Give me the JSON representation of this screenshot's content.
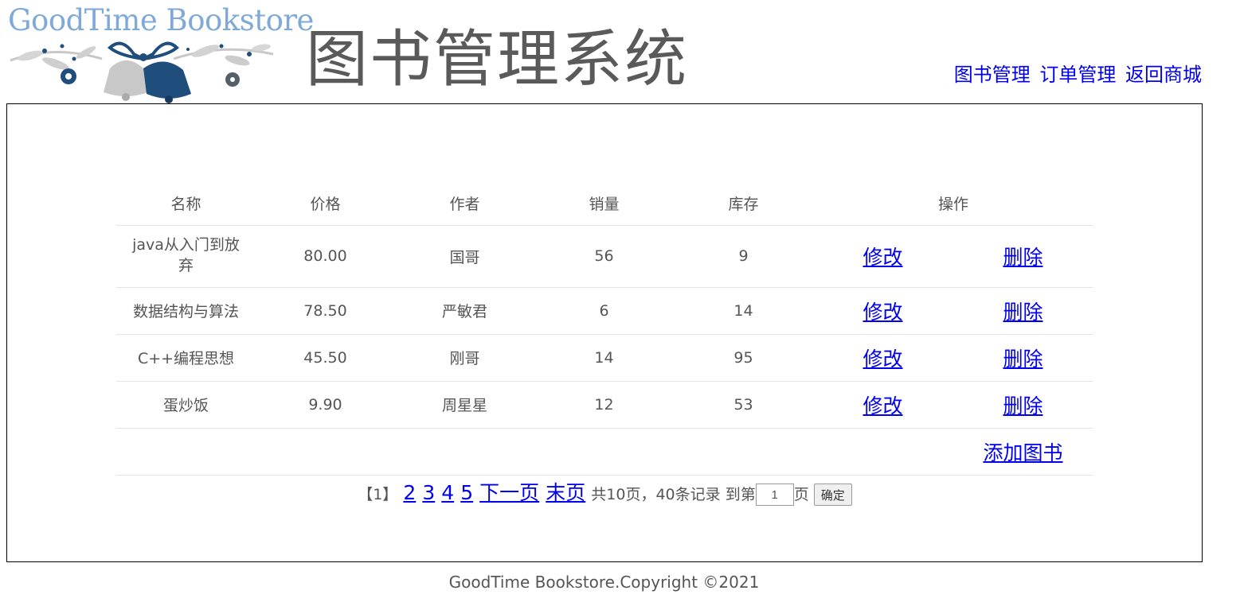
{
  "header": {
    "logo_text": "GoodTime Bookstore",
    "title": "图书管理系统",
    "nav": [
      {
        "label": "图书管理"
      },
      {
        "label": "订单管理"
      },
      {
        "label": "返回商城"
      }
    ]
  },
  "table": {
    "columns": [
      "名称",
      "价格",
      "作者",
      "销量",
      "库存",
      "操作"
    ],
    "rows": [
      {
        "name": "java从入门到放弃",
        "price": "80.00",
        "author": "国哥",
        "sales": "56",
        "stock": "9",
        "edit": "修改",
        "delete": "删除"
      },
      {
        "name": "数据结构与算法",
        "price": "78.50",
        "author": "严敏君",
        "sales": "6",
        "stock": "14",
        "edit": "修改",
        "delete": "删除"
      },
      {
        "name": "C++编程思想",
        "price": "45.50",
        "author": "刚哥",
        "sales": "14",
        "stock": "95",
        "edit": "修改",
        "delete": "删除"
      },
      {
        "name": "蛋炒饭",
        "price": "9.90",
        "author": "周星星",
        "sales": "12",
        "stock": "53",
        "edit": "修改",
        "delete": "删除"
      }
    ],
    "add_label": "添加图书"
  },
  "pagination": {
    "current": "【1】",
    "pages": [
      "2",
      "3",
      "4",
      "5"
    ],
    "next_label": "下一页",
    "last_label": "末页",
    "summary": "共10页，40条记录 到第",
    "goto_value": "1",
    "page_suffix": "页",
    "confirm_label": "确定"
  },
  "footer": {
    "copyright": "GoodTime Bookstore.Copyright ©2021"
  },
  "colors": {
    "link": "#0000ee",
    "text": "#555555",
    "logo_blue": "#1f4e7d",
    "logo_light": "#7fa9d8"
  }
}
